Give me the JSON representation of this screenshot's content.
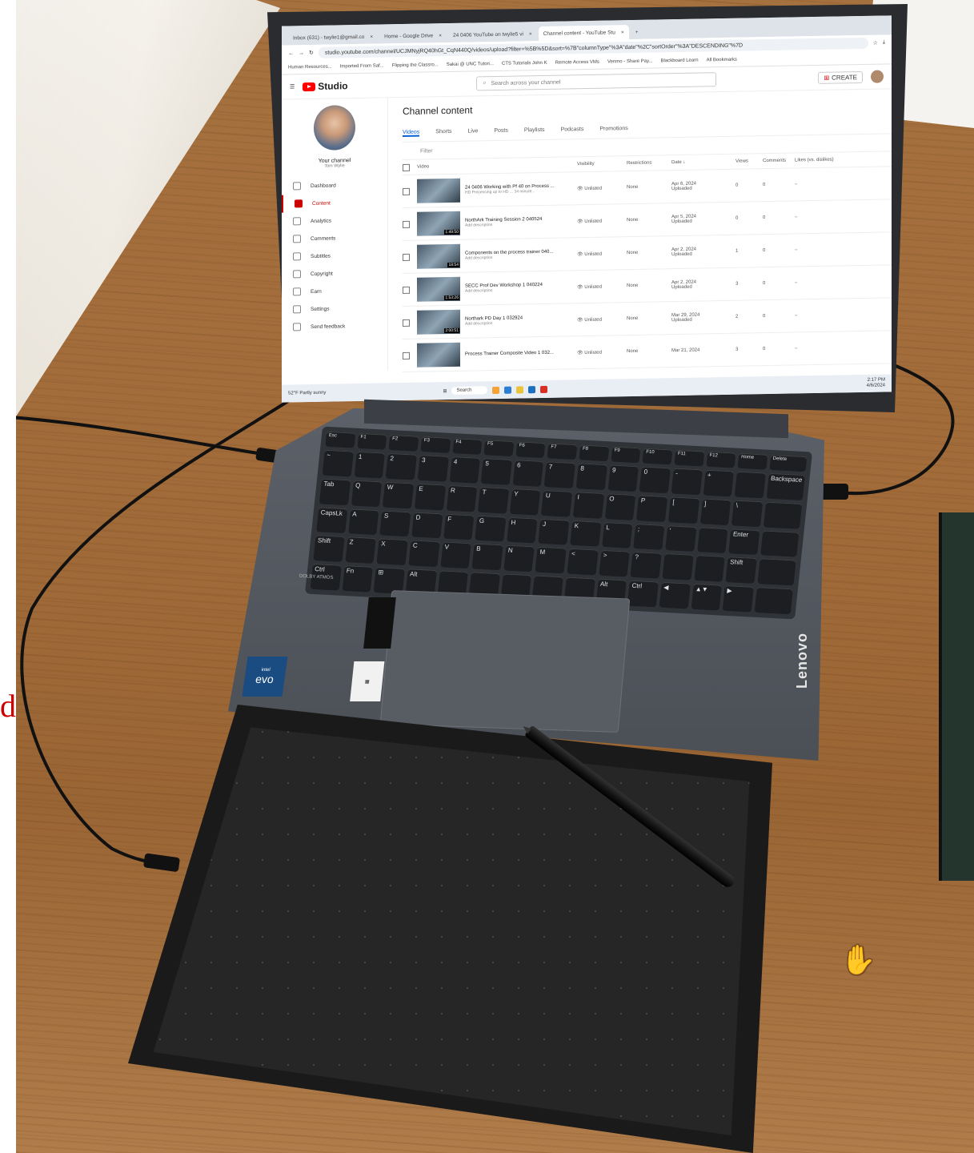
{
  "margin_letter": "d",
  "browser": {
    "tabs": [
      {
        "label": "Inbox (631) - twylie1@gmail.co",
        "active": false
      },
      {
        "label": "Home - Google Drive",
        "active": false
      },
      {
        "label": "24 0406 YouTube on twylie5 vi",
        "active": false
      },
      {
        "label": "Channel content - YouTube Stu",
        "active": true
      }
    ],
    "url": "studio.youtube.com/channel/UCJMNyjRQ40hGt_CqN440Q/videos/upload?filter=%5B%5D&sort=%7B\"columnType\"%3A\"date\"%2C\"sortOrder\"%3A\"DESCENDING\"%7D",
    "bookmarks": [
      "Human Resources...",
      "Imported From Saf...",
      "Flipping the Classro...",
      "Sakai @ UNC Tutori...",
      "CTS Tutorials John K",
      "Remote Access VMs",
      "Venmo - Share Pay...",
      "Blackboard Learn",
      "All Bookmarks"
    ]
  },
  "studio": {
    "logo": "Studio",
    "search_placeholder": "Search across your channel",
    "create_label": "CREATE",
    "your_channel": "Your channel",
    "channel_name": "Tom Wylie",
    "nav": [
      "Dashboard",
      "Content",
      "Analytics",
      "Comments",
      "Subtitles",
      "Copyright",
      "Earn",
      "Settings",
      "Send feedback"
    ],
    "page_title": "Channel content",
    "tabs": [
      "Videos",
      "Shorts",
      "Live",
      "Posts",
      "Playlists",
      "Podcasts",
      "Promotions"
    ],
    "filter_placeholder": "Filter",
    "columns": [
      "Video",
      "Visibility",
      "Restrictions",
      "Date ↓",
      "Views",
      "Comments",
      "Likes (vs. dislikes)"
    ],
    "rows": [
      {
        "title": "24 0406 Working with Pf 40 on Process ...",
        "sub": "HD Processing up to HD ... 34 minute...",
        "duration": "",
        "visibility": "Unlisted",
        "restrictions": "None",
        "date": "Apr 6, 2024",
        "status": "Uploaded",
        "views": "0",
        "comments": "0"
      },
      {
        "title": "NorthArk Training Session 2 040524",
        "sub": "Add description",
        "duration": "1:49:50",
        "visibility": "Unlisted",
        "restrictions": "None",
        "date": "Apr 5, 2024",
        "status": "Uploaded",
        "views": "0",
        "comments": "0"
      },
      {
        "title": "Components on the process trainer 040...",
        "sub": "Add description",
        "duration": "18:54",
        "visibility": "Unlisted",
        "restrictions": "None",
        "date": "Apr 2, 2024",
        "status": "Uploaded",
        "views": "1",
        "comments": "0"
      },
      {
        "title": "SECC Prof Dev Workshop 1 040224",
        "sub": "Add description",
        "duration": "1:53:26",
        "visibility": "Unlisted",
        "restrictions": "None",
        "date": "Apr 2, 2024",
        "status": "Uploaded",
        "views": "3",
        "comments": "0"
      },
      {
        "title": "Northark PD Day 1 032924",
        "sub": "Add description",
        "duration": "2:00:51",
        "visibility": "Unlisted",
        "restrictions": "None",
        "date": "Mar 29, 2024",
        "status": "Uploaded",
        "views": "2",
        "comments": "0"
      },
      {
        "title": "Process Trainer Composite Video 1 032...",
        "sub": "",
        "duration": "",
        "visibility": "Unlisted",
        "restrictions": "None",
        "date": "Mar 21, 2024",
        "status": "",
        "views": "3",
        "comments": "0"
      }
    ]
  },
  "taskbar": {
    "weather_temp": "52°F",
    "weather_desc": "Partly sunny",
    "search": "Search",
    "time": "2:17 PM",
    "date": "4/6/2024"
  },
  "keyboard": {
    "rows": [
      [
        "Esc",
        "F1",
        "F2",
        "F3",
        "F4",
        "F5",
        "F6",
        "F7",
        "F8",
        "F9",
        "F10",
        "F11",
        "F12",
        "Home",
        "Delete"
      ],
      [
        "~",
        "1",
        "2",
        "3",
        "4",
        "5",
        "6",
        "7",
        "8",
        "9",
        "0",
        "-",
        "+",
        "",
        "Backspace"
      ],
      [
        "Tab",
        "Q",
        "W",
        "E",
        "R",
        "T",
        "Y",
        "U",
        "I",
        "O",
        "P",
        "[",
        "]",
        "\\",
        ""
      ],
      [
        "CapsLk",
        "A",
        "S",
        "D",
        "F",
        "G",
        "H",
        "J",
        "K",
        "L",
        ";",
        "'",
        "",
        "Enter",
        ""
      ],
      [
        "Shift",
        "Z",
        "X",
        "C",
        "V",
        "B",
        "N",
        "M",
        "<",
        ">",
        "?",
        "",
        "",
        "Shift",
        ""
      ],
      [
        "Ctrl",
        "Fn",
        "⊞",
        "Alt",
        "",
        "",
        "",
        "",
        "",
        "Alt",
        "Ctrl",
        "◀",
        "▲▼",
        "▶",
        ""
      ]
    ]
  },
  "brand": {
    "laptop": "Lenovo",
    "evo": "evo",
    "intel": "intel",
    "dolby": "DOLBY ATMOS"
  },
  "colors": {
    "wood": "#a26c3a",
    "laptop": "#4b4f56",
    "tablet": "#1a1a1a",
    "accent_red": "#ff0000",
    "margin_text": "#cc0000"
  }
}
